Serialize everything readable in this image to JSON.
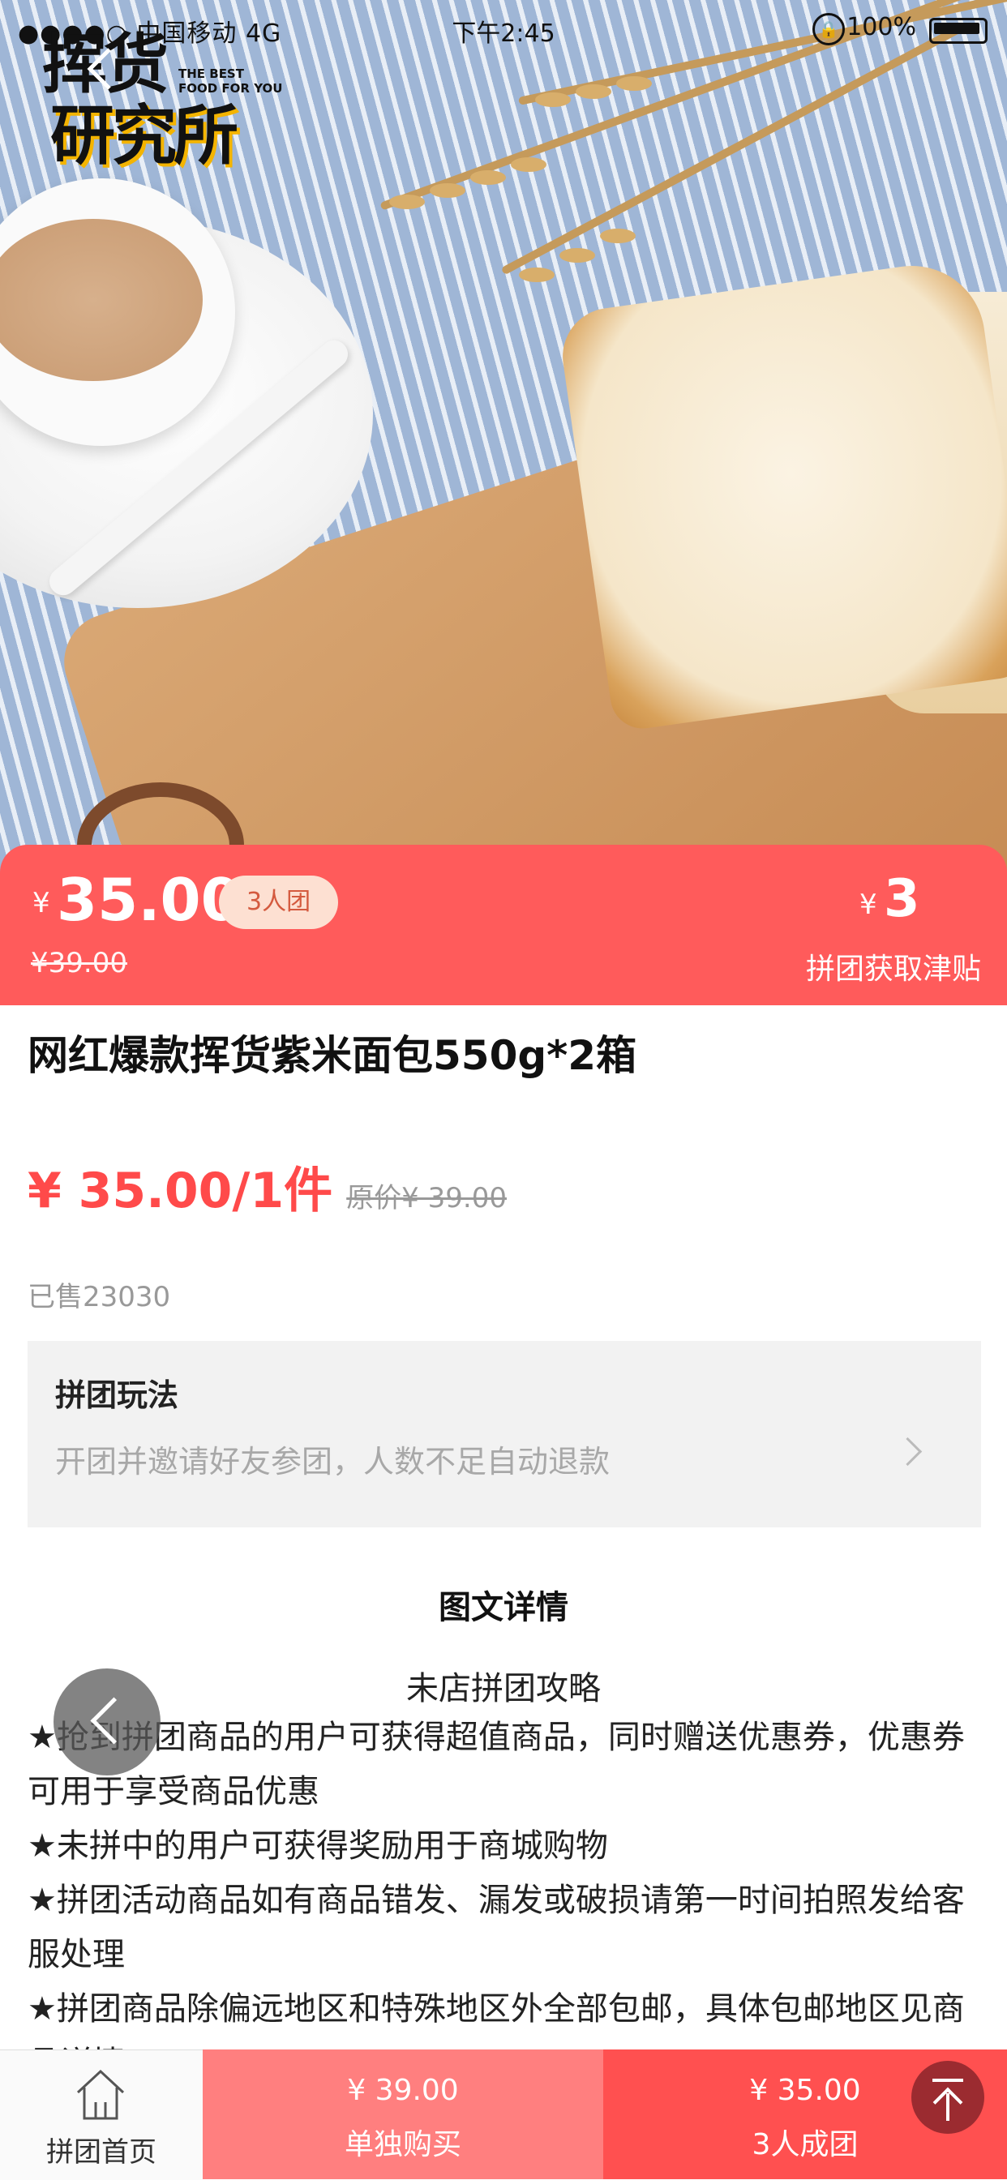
{
  "status_bar": {
    "signal": "●●●●○ 中国移动 4G",
    "time": "下午2:45",
    "battery_pct": "100%"
  },
  "logo": {
    "line1": "挥货",
    "line2": "研究所",
    "tagline": "THE BEST FOOD FOR YOU"
  },
  "banner": {
    "currency": "¥",
    "price": "35.00",
    "group_tag": "3人团",
    "original_price": "¥39.00",
    "subsidy_currency": "¥",
    "subsidy_amount": "3",
    "subsidy_label": "拼团获取津贴"
  },
  "product": {
    "title": "网红爆款挥货紫米面包550g*2箱",
    "price_per_unit": "¥ 35.00/1件",
    "original_price": "原价¥ 39.00",
    "sold": "已售23030"
  },
  "group_rules": {
    "heading": "拼团玩法",
    "description": "开团并邀请好友参团，人数不足自动退款"
  },
  "details": {
    "section_title": "图文详情",
    "subtitle": "未店拼团攻略",
    "items": [
      "★抢到拼团商品的用户可获得超值商品，同时赠送优惠券，优惠券可用于享受商品优惠",
      "★未拼中的用户可获得奖励用于商城购物",
      "★拼团活动商品如有商品错发、漏发或破损请第一时间拍照发给客服处理",
      "★拼团商品除偏远地区和特殊地区外全部包邮，具体包邮地区见商品详情"
    ]
  },
  "bottom_bar": {
    "home_label": "拼团首页",
    "solo_price": "¥ 39.00",
    "solo_label": "单独购买",
    "group_price": "¥ 35.00",
    "group_label": "3人成团"
  },
  "colors": {
    "accent": "#ff5b5b",
    "solo_button": "#ff7f7f",
    "group_button": "#ff5050",
    "price_text": "#ff4a4a"
  }
}
